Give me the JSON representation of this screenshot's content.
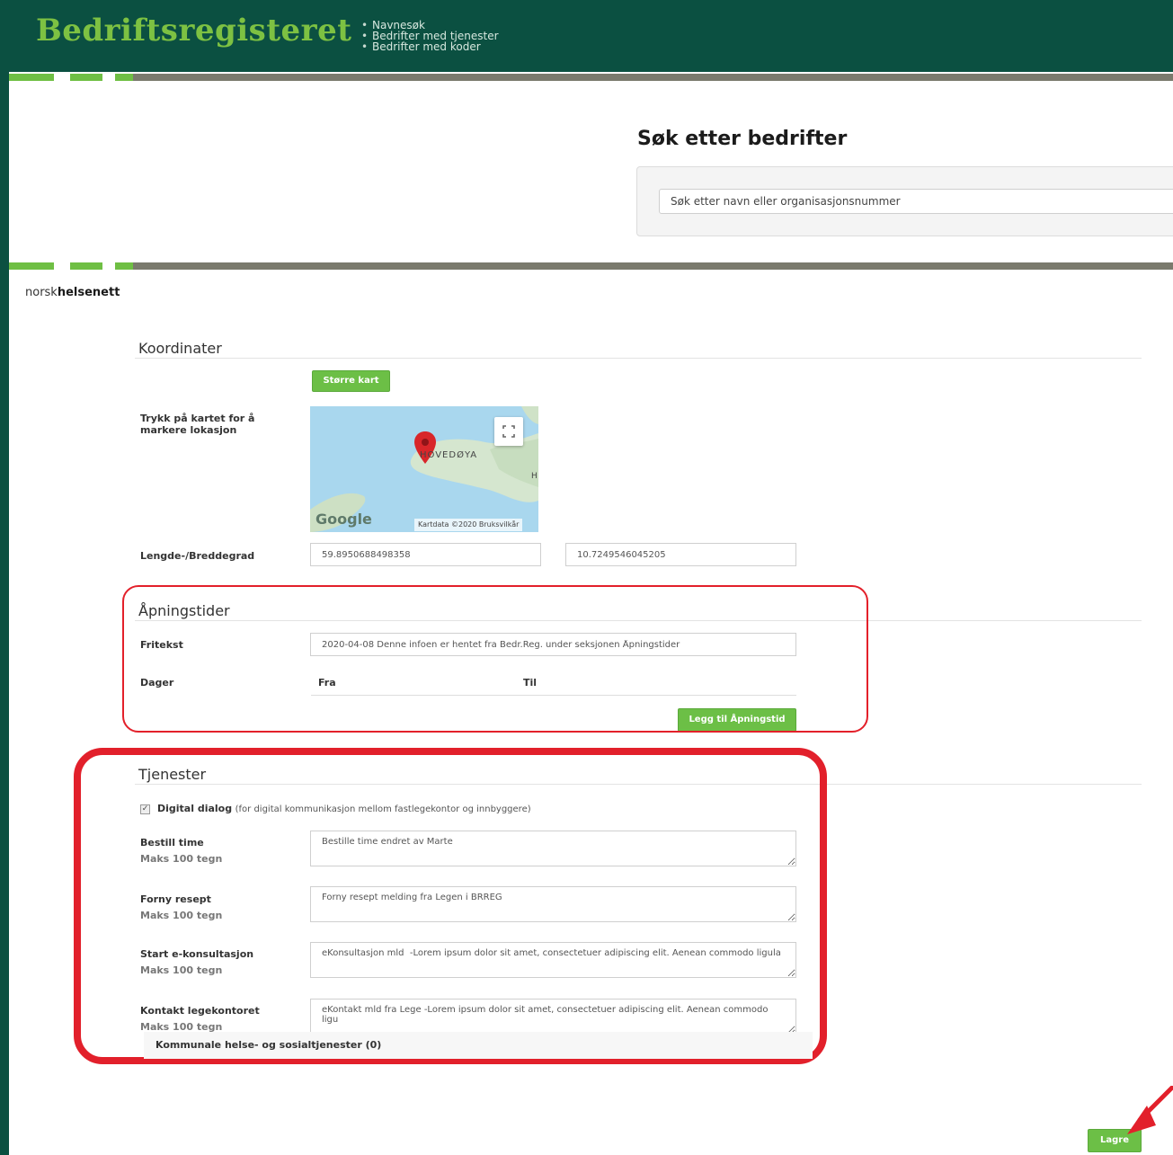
{
  "header": {
    "brand": "Bedriftsregisteret",
    "nav": [
      "Navnesøk",
      "Bedrifter med tjenester",
      "Bedrifter med koder"
    ]
  },
  "search": {
    "title": "Søk etter bedrifter",
    "placeholder": "Søk etter navn eller organisasjonsnummer"
  },
  "logo": {
    "part1": "norsk",
    "part2": "helsenett"
  },
  "koordinater": {
    "title": "Koordinater",
    "bigger_map_button": "Større kart",
    "map_instruction": "Trykk på kartet for å markere lokasjon",
    "map": {
      "place_label": "HOVEDØYA",
      "edge_label": "H",
      "google": "Google",
      "attribution": "Kartdata ©2020  Bruksvilkår"
    },
    "latlong_label": "Lengde-/Breddegrad",
    "latitude": "59.8950688498358",
    "longitude": "10.7249546045205"
  },
  "apningstider": {
    "title": "Åpningstider",
    "fritekst_label": "Fritekst",
    "fritekst_value": "2020-04-08 Denne infoen er hentet fra Bedr.Reg. under seksjonen Åpningstider",
    "columns": [
      "Dager",
      "Fra",
      "Til"
    ],
    "add_button": "Legg til Åpningstid"
  },
  "tjenester": {
    "title": "Tjenester",
    "digital_dialog_label": "Digital dialog",
    "digital_dialog_desc": "(for digital kommunikasjon mellom fastlegekontor og innbyggere)",
    "digital_dialog_checked": true,
    "fields": [
      {
        "label": "Bestill time",
        "sub": "Maks 100 tegn",
        "value": "Bestille time endret av Marte"
      },
      {
        "label": "Forny resept",
        "sub": "Maks 100 tegn",
        "value": "Forny resept melding fra Legen i BRREG"
      },
      {
        "label": "Start e-konsultasjon",
        "sub": "Maks 100 tegn",
        "value": "eKonsultasjon mld  -Lorem ipsum dolor sit amet, consectetuer adipiscing elit. Aenean commodo ligula"
      },
      {
        "label": "Kontakt legekontoret",
        "sub": "Maks 100 tegn",
        "value": "eKontakt mld fra Lege -Lorem ipsum dolor sit amet, consectetuer adipiscing elit. Aenean commodo ligu"
      }
    ],
    "kommunale": "Kommunale helse- og sosialtjenester (0)"
  },
  "save_button": "Lagre",
  "colors": {
    "brand_green": "#7dc142",
    "header_bg": "#0b5041",
    "button_green": "#6cbf46",
    "annotation_red": "#e2202b"
  }
}
